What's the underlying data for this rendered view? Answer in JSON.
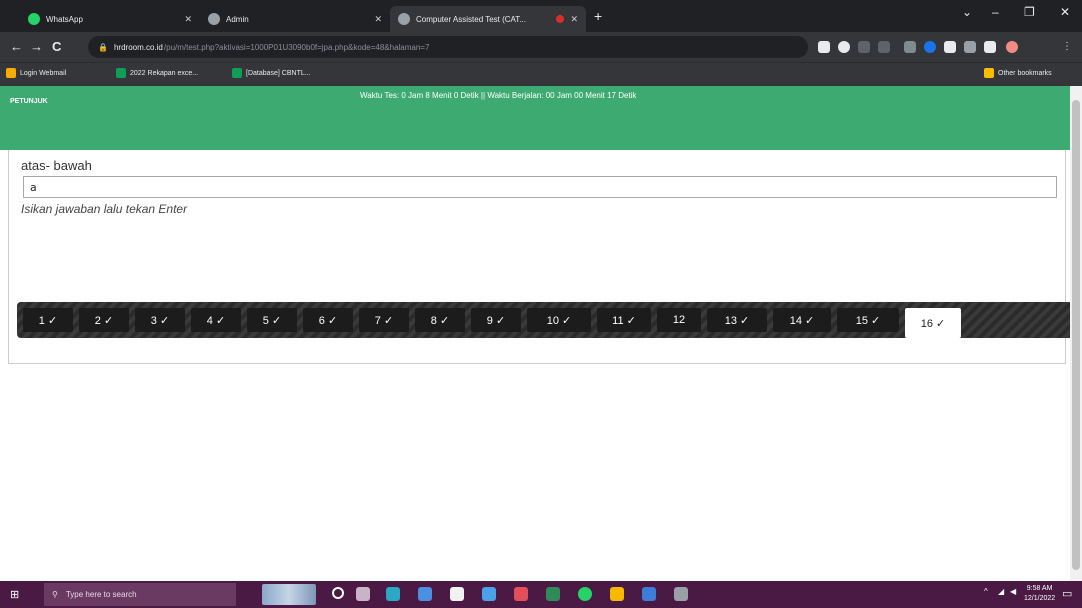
{
  "browser": {
    "tabs": [
      {
        "label": "WhatsApp",
        "close": "✕"
      },
      {
        "label": "Admin",
        "close": "✕"
      },
      {
        "label": "Computer Assisted Test (CAT...",
        "close": "✕"
      }
    ],
    "new_tab": "+",
    "window_controls": {
      "chevron": "⌄",
      "minimize": "–",
      "restore": "❐",
      "close": "✕"
    },
    "nav": {
      "back": "←",
      "forward": "→",
      "reload": "C"
    },
    "address": {
      "domain": "hrdroom.co.id",
      "path": "/pu/m/test.php?aktivasi=1000P01U3090b0f=jpa.php&kode=48&halaman=7"
    },
    "bookmarks": [
      "Login Webmail",
      "2022 Rekapan exce...",
      "[Database] CBNTL..."
    ],
    "other_bookmarks": "Other bookmarks"
  },
  "page": {
    "petunjuk": "PETUNJUK",
    "timer_text": "Waktu Tes: 0 Jam 8 Menit 0 Detik || Waktu Berjalan: 00 Jam 00 Menit 17 Detik",
    "question": "atas- bawah",
    "answer_value": "a",
    "hint": "Isikan jawaban lalu tekan Enter",
    "question_numbers": [
      "1 ✓",
      "2 ✓",
      "3 ✓",
      "4 ✓",
      "5 ✓",
      "6 ✓",
      "7 ✓",
      "8 ✓",
      "9 ✓",
      "10 ✓",
      "11 ✓",
      "12",
      "13 ✓",
      "14 ✓",
      "15 ✓",
      "16 ✓"
    ],
    "active_question": "16 ✓"
  },
  "taskbar": {
    "search_placeholder": "Type here to search",
    "time": "9:58 AM",
    "date": "12/1/2022",
    "tray_chevron": "^"
  },
  "colors": {
    "header_green": "#3daa72",
    "taskbar": "#4b1a44"
  }
}
